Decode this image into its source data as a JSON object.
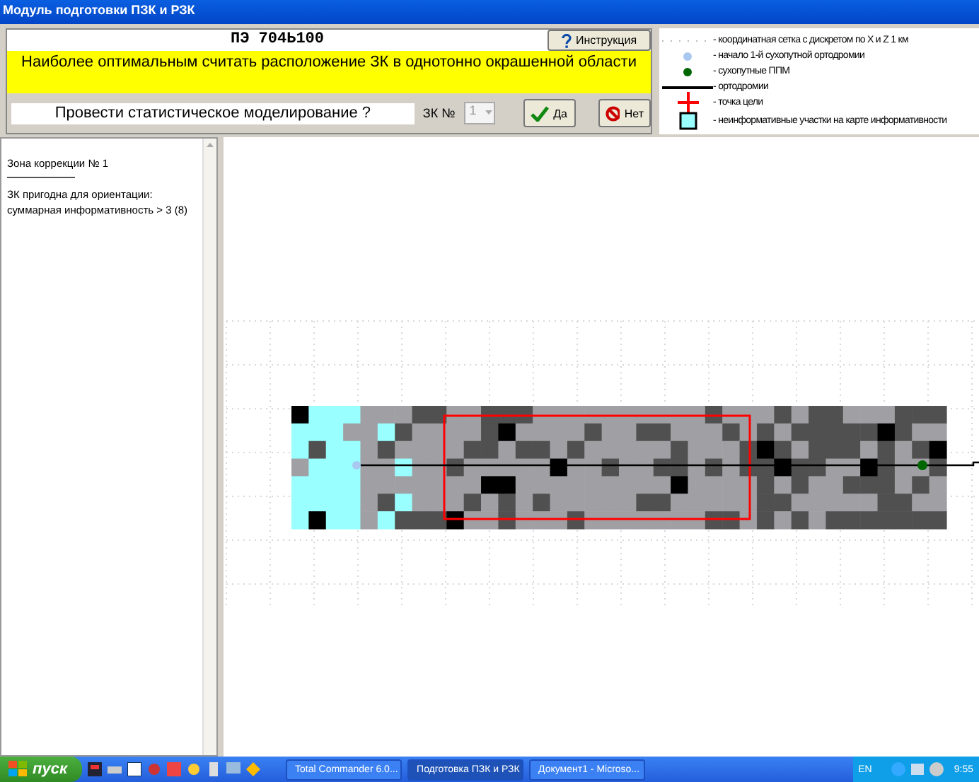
{
  "window": {
    "title": "Модуль подготовки ПЗК и РЗК"
  },
  "header": {
    "code": "ПЭ  704Ь100",
    "help_button": "Инструкция",
    "message": "Наиболее оптимальным считать расположение ЗК в однотонно окрашенной области",
    "question": "Провести статистическое моделирование ?",
    "zk_label": "ЗК №",
    "zk_value": "1",
    "zk_disabled": true,
    "yes_button": "Да",
    "no_button": "Нет"
  },
  "legend": [
    {
      "kind": "grid",
      "text": "- координатная сетка с дискретом  по X и Z  1 км"
    },
    {
      "kind": "start-dot",
      "text": "- начало 1-й сухопутной ортодромии"
    },
    {
      "kind": "ppm-dot",
      "text": "- сухопутные ППМ"
    },
    {
      "kind": "line",
      "text": "- ортодромии"
    },
    {
      "kind": "cross",
      "text": "- точка цели"
    },
    {
      "kind": "square",
      "text": "- неинформативные участки на карте информативности"
    }
  ],
  "info_panel": [
    {
      "kind": "text",
      "text": "Зона коррекции № 1"
    },
    {
      "kind": "rule"
    },
    {
      "kind": "text",
      "text": "ЗК пригодна для ориентации:"
    },
    {
      "kind": "text",
      "text": " суммарная информативность > 3 (8)"
    }
  ],
  "taskbar": {
    "start": "пуск",
    "tasks": [
      {
        "label": "Total Commander 6.0...",
        "selected": false
      },
      {
        "label": "Подготовка ПЗК и РЗК",
        "selected": true
      },
      {
        "label": "Документ1 - Microso...",
        "selected": false
      }
    ],
    "language": "EN",
    "clock": "9:55"
  }
}
